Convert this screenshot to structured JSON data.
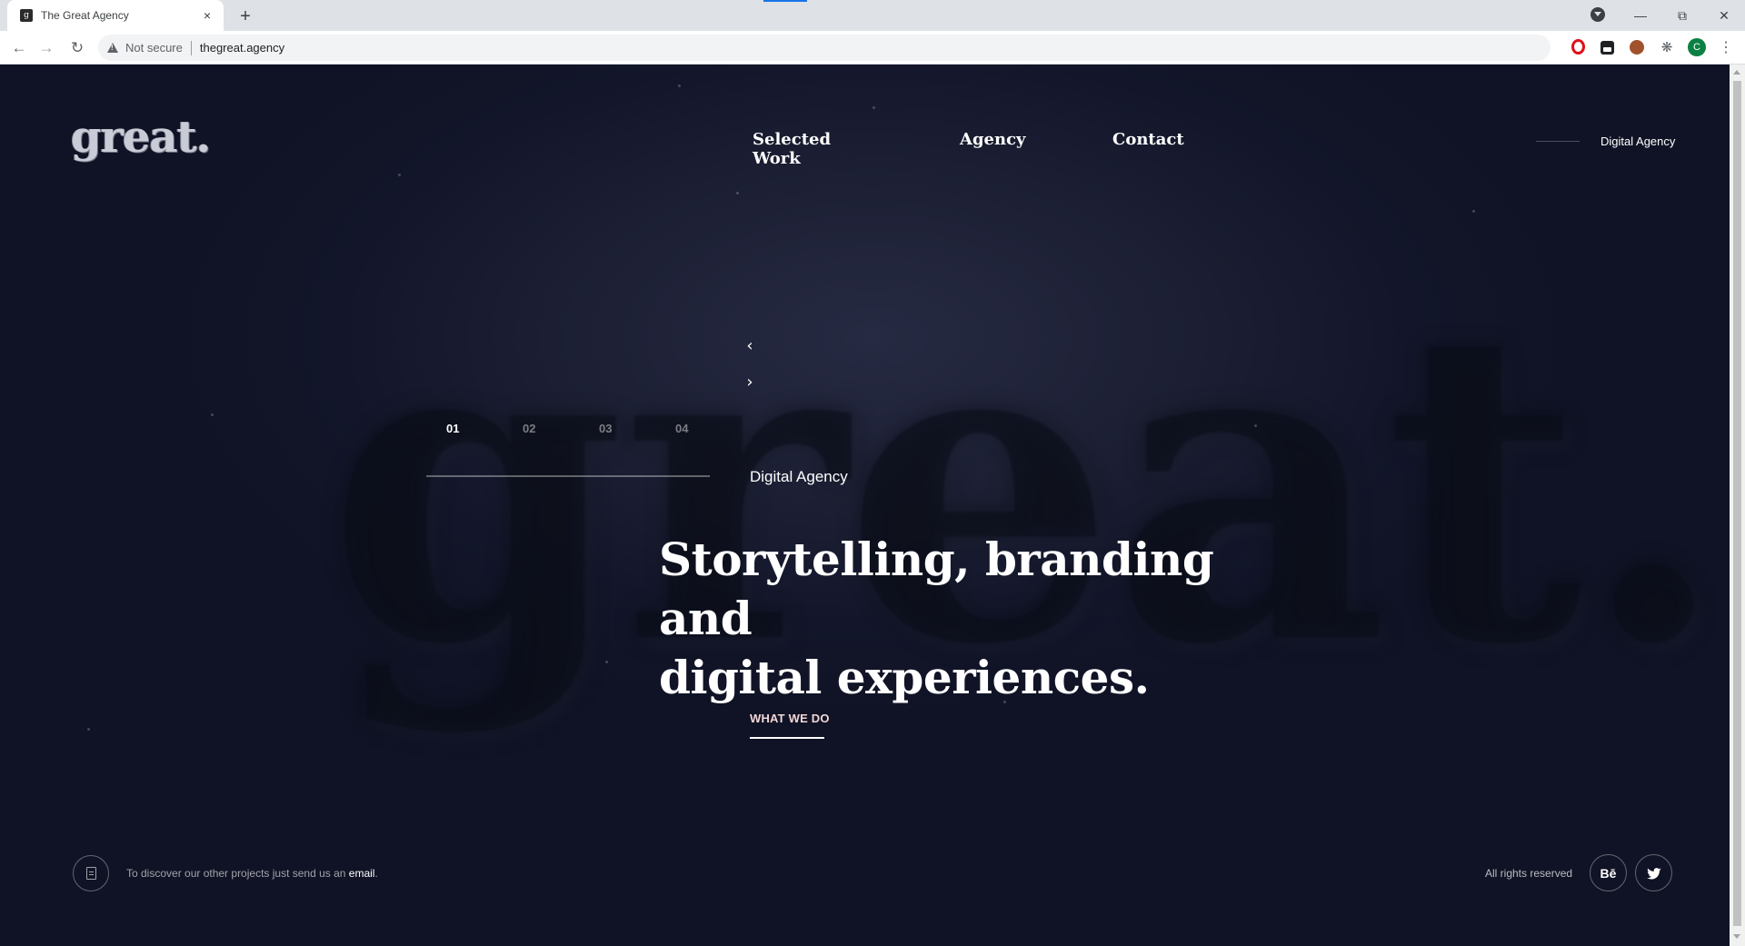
{
  "browser": {
    "tab_title": "The Great Agency",
    "tab_close_glyph": "×",
    "new_tab_glyph": "+",
    "security_label": "Not secure",
    "url": "thegreat.agency",
    "profile_initial": "C",
    "icons": [
      "back-icon",
      "forward-icon",
      "reload-icon",
      "warning-icon",
      "star-icon",
      "opera-icon",
      "extension-box-icon",
      "cookie-icon",
      "puzzle-icon",
      "menu-dots-icon",
      "minimize-icon",
      "restore-icon",
      "close-icon",
      "tab-search-icon"
    ]
  },
  "site": {
    "logo": "great.",
    "nav": {
      "selected_work": "Selected Work",
      "agency": "Agency",
      "contact": "Contact"
    },
    "top_right_label": "Digital Agency",
    "slider": {
      "prev_glyph": "‹",
      "next_glyph": "›",
      "numbers": [
        "01",
        "02",
        "03",
        "04"
      ],
      "active_index": 0
    },
    "eyebrow": "Digital Agency",
    "headline_line1": "Storytelling, branding and",
    "headline_line2": "digital experiences.",
    "cta": "WHAT WE DO",
    "background_word": "great.",
    "footer": {
      "text_prefix": "To discover our other projects just send us an ",
      "email_link": "email",
      "text_suffix": ".",
      "rights": "All rights reserved",
      "behance_label": "Bē"
    }
  },
  "colors": {
    "background": "#1c1f33",
    "text": "#ffffff",
    "cta": "#f3d7d7"
  }
}
